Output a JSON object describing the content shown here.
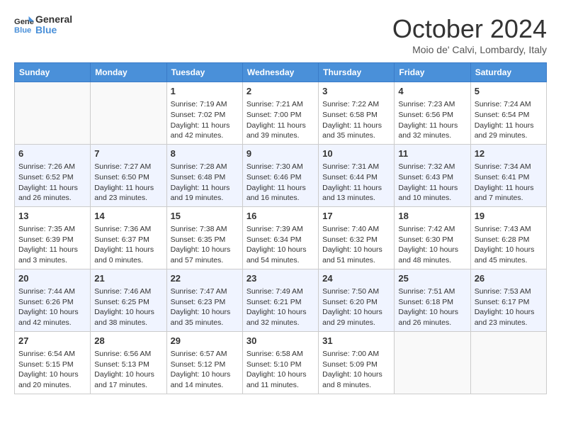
{
  "header": {
    "logo_line1": "General",
    "logo_line2": "Blue",
    "month": "October 2024",
    "location": "Moio de' Calvi, Lombardy, Italy"
  },
  "days_of_week": [
    "Sunday",
    "Monday",
    "Tuesday",
    "Wednesday",
    "Thursday",
    "Friday",
    "Saturday"
  ],
  "weeks": [
    [
      {
        "day": "",
        "sunrise": "",
        "sunset": "",
        "daylight": ""
      },
      {
        "day": "",
        "sunrise": "",
        "sunset": "",
        "daylight": ""
      },
      {
        "day": "1",
        "sunrise": "Sunrise: 7:19 AM",
        "sunset": "Sunset: 7:02 PM",
        "daylight": "Daylight: 11 hours and 42 minutes."
      },
      {
        "day": "2",
        "sunrise": "Sunrise: 7:21 AM",
        "sunset": "Sunset: 7:00 PM",
        "daylight": "Daylight: 11 hours and 39 minutes."
      },
      {
        "day": "3",
        "sunrise": "Sunrise: 7:22 AM",
        "sunset": "Sunset: 6:58 PM",
        "daylight": "Daylight: 11 hours and 35 minutes."
      },
      {
        "day": "4",
        "sunrise": "Sunrise: 7:23 AM",
        "sunset": "Sunset: 6:56 PM",
        "daylight": "Daylight: 11 hours and 32 minutes."
      },
      {
        "day": "5",
        "sunrise": "Sunrise: 7:24 AM",
        "sunset": "Sunset: 6:54 PM",
        "daylight": "Daylight: 11 hours and 29 minutes."
      }
    ],
    [
      {
        "day": "6",
        "sunrise": "Sunrise: 7:26 AM",
        "sunset": "Sunset: 6:52 PM",
        "daylight": "Daylight: 11 hours and 26 minutes."
      },
      {
        "day": "7",
        "sunrise": "Sunrise: 7:27 AM",
        "sunset": "Sunset: 6:50 PM",
        "daylight": "Daylight: 11 hours and 23 minutes."
      },
      {
        "day": "8",
        "sunrise": "Sunrise: 7:28 AM",
        "sunset": "Sunset: 6:48 PM",
        "daylight": "Daylight: 11 hours and 19 minutes."
      },
      {
        "day": "9",
        "sunrise": "Sunrise: 7:30 AM",
        "sunset": "Sunset: 6:46 PM",
        "daylight": "Daylight: 11 hours and 16 minutes."
      },
      {
        "day": "10",
        "sunrise": "Sunrise: 7:31 AM",
        "sunset": "Sunset: 6:44 PM",
        "daylight": "Daylight: 11 hours and 13 minutes."
      },
      {
        "day": "11",
        "sunrise": "Sunrise: 7:32 AM",
        "sunset": "Sunset: 6:43 PM",
        "daylight": "Daylight: 11 hours and 10 minutes."
      },
      {
        "day": "12",
        "sunrise": "Sunrise: 7:34 AM",
        "sunset": "Sunset: 6:41 PM",
        "daylight": "Daylight: 11 hours and 7 minutes."
      }
    ],
    [
      {
        "day": "13",
        "sunrise": "Sunrise: 7:35 AM",
        "sunset": "Sunset: 6:39 PM",
        "daylight": "Daylight: 11 hours and 3 minutes."
      },
      {
        "day": "14",
        "sunrise": "Sunrise: 7:36 AM",
        "sunset": "Sunset: 6:37 PM",
        "daylight": "Daylight: 11 hours and 0 minutes."
      },
      {
        "day": "15",
        "sunrise": "Sunrise: 7:38 AM",
        "sunset": "Sunset: 6:35 PM",
        "daylight": "Daylight: 10 hours and 57 minutes."
      },
      {
        "day": "16",
        "sunrise": "Sunrise: 7:39 AM",
        "sunset": "Sunset: 6:34 PM",
        "daylight": "Daylight: 10 hours and 54 minutes."
      },
      {
        "day": "17",
        "sunrise": "Sunrise: 7:40 AM",
        "sunset": "Sunset: 6:32 PM",
        "daylight": "Daylight: 10 hours and 51 minutes."
      },
      {
        "day": "18",
        "sunrise": "Sunrise: 7:42 AM",
        "sunset": "Sunset: 6:30 PM",
        "daylight": "Daylight: 10 hours and 48 minutes."
      },
      {
        "day": "19",
        "sunrise": "Sunrise: 7:43 AM",
        "sunset": "Sunset: 6:28 PM",
        "daylight": "Daylight: 10 hours and 45 minutes."
      }
    ],
    [
      {
        "day": "20",
        "sunrise": "Sunrise: 7:44 AM",
        "sunset": "Sunset: 6:26 PM",
        "daylight": "Daylight: 10 hours and 42 minutes."
      },
      {
        "day": "21",
        "sunrise": "Sunrise: 7:46 AM",
        "sunset": "Sunset: 6:25 PM",
        "daylight": "Daylight: 10 hours and 38 minutes."
      },
      {
        "day": "22",
        "sunrise": "Sunrise: 7:47 AM",
        "sunset": "Sunset: 6:23 PM",
        "daylight": "Daylight: 10 hours and 35 minutes."
      },
      {
        "day": "23",
        "sunrise": "Sunrise: 7:49 AM",
        "sunset": "Sunset: 6:21 PM",
        "daylight": "Daylight: 10 hours and 32 minutes."
      },
      {
        "day": "24",
        "sunrise": "Sunrise: 7:50 AM",
        "sunset": "Sunset: 6:20 PM",
        "daylight": "Daylight: 10 hours and 29 minutes."
      },
      {
        "day": "25",
        "sunrise": "Sunrise: 7:51 AM",
        "sunset": "Sunset: 6:18 PM",
        "daylight": "Daylight: 10 hours and 26 minutes."
      },
      {
        "day": "26",
        "sunrise": "Sunrise: 7:53 AM",
        "sunset": "Sunset: 6:17 PM",
        "daylight": "Daylight: 10 hours and 23 minutes."
      }
    ],
    [
      {
        "day": "27",
        "sunrise": "Sunrise: 6:54 AM",
        "sunset": "Sunset: 5:15 PM",
        "daylight": "Daylight: 10 hours and 20 minutes."
      },
      {
        "day": "28",
        "sunrise": "Sunrise: 6:56 AM",
        "sunset": "Sunset: 5:13 PM",
        "daylight": "Daylight: 10 hours and 17 minutes."
      },
      {
        "day": "29",
        "sunrise": "Sunrise: 6:57 AM",
        "sunset": "Sunset: 5:12 PM",
        "daylight": "Daylight: 10 hours and 14 minutes."
      },
      {
        "day": "30",
        "sunrise": "Sunrise: 6:58 AM",
        "sunset": "Sunset: 5:10 PM",
        "daylight": "Daylight: 10 hours and 11 minutes."
      },
      {
        "day": "31",
        "sunrise": "Sunrise: 7:00 AM",
        "sunset": "Sunset: 5:09 PM",
        "daylight": "Daylight: 10 hours and 8 minutes."
      },
      {
        "day": "",
        "sunrise": "",
        "sunset": "",
        "daylight": ""
      },
      {
        "day": "",
        "sunrise": "",
        "sunset": "",
        "daylight": ""
      }
    ]
  ]
}
